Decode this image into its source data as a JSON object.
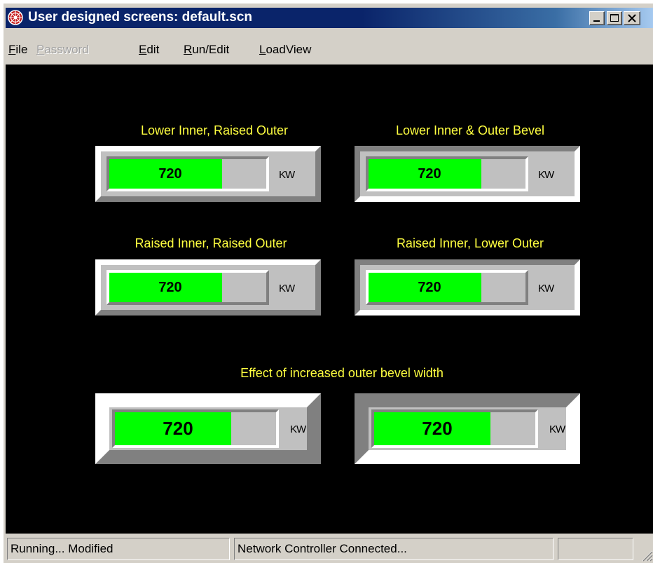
{
  "window": {
    "title": "User designed screens: default.scn",
    "menu": [
      {
        "label": "File",
        "accel": "F",
        "rest": "ile",
        "enabled": true
      },
      {
        "label": "Password",
        "accel": "P",
        "rest": "assword",
        "enabled": false
      },
      {
        "label": "Edit",
        "accel": "E",
        "rest": "dit",
        "enabled": true
      },
      {
        "label": "Run/Edit",
        "accel": "R",
        "rest": "un/Edit",
        "enabled": true
      },
      {
        "label": "LoadView",
        "accel": "L",
        "rest": "oadView",
        "enabled": true
      }
    ]
  },
  "panels": {
    "p1": {
      "title": "Lower Inner, Raised Outer",
      "value": "720",
      "unit": "KW",
      "fill_fraction": 0.72
    },
    "p2": {
      "title": "Lower Inner & Outer Bevel",
      "value": "720",
      "unit": "KW",
      "fill_fraction": 0.72
    },
    "p3": {
      "title": "Raised Inner, Raised Outer",
      "value": "720",
      "unit": "KW",
      "fill_fraction": 0.72
    },
    "p4": {
      "title": "Raised Inner, Lower Outer",
      "value": "720",
      "unit": "KW",
      "fill_fraction": 0.72
    },
    "section_title": "Effect of increased outer bevel width",
    "p5": {
      "value": "720",
      "unit": "KW",
      "fill_fraction": 0.72
    },
    "p6": {
      "value": "720",
      "unit": "KW",
      "fill_fraction": 0.72
    }
  },
  "status": {
    "left": "Running... Modified",
    "middle": "Network Controller Connected...",
    "right": ""
  },
  "colors": {
    "canvas": "#000000",
    "label": "#ffff40",
    "bar_fill": "#00ff00",
    "panel_face": "#c0c0c0",
    "titlebar": "#0a246a"
  },
  "icons": {
    "app": "app-logo-icon",
    "minimize": "minimize-icon",
    "maximize": "maximize-icon",
    "close": "close-icon",
    "grip": "resize-grip-icon"
  }
}
